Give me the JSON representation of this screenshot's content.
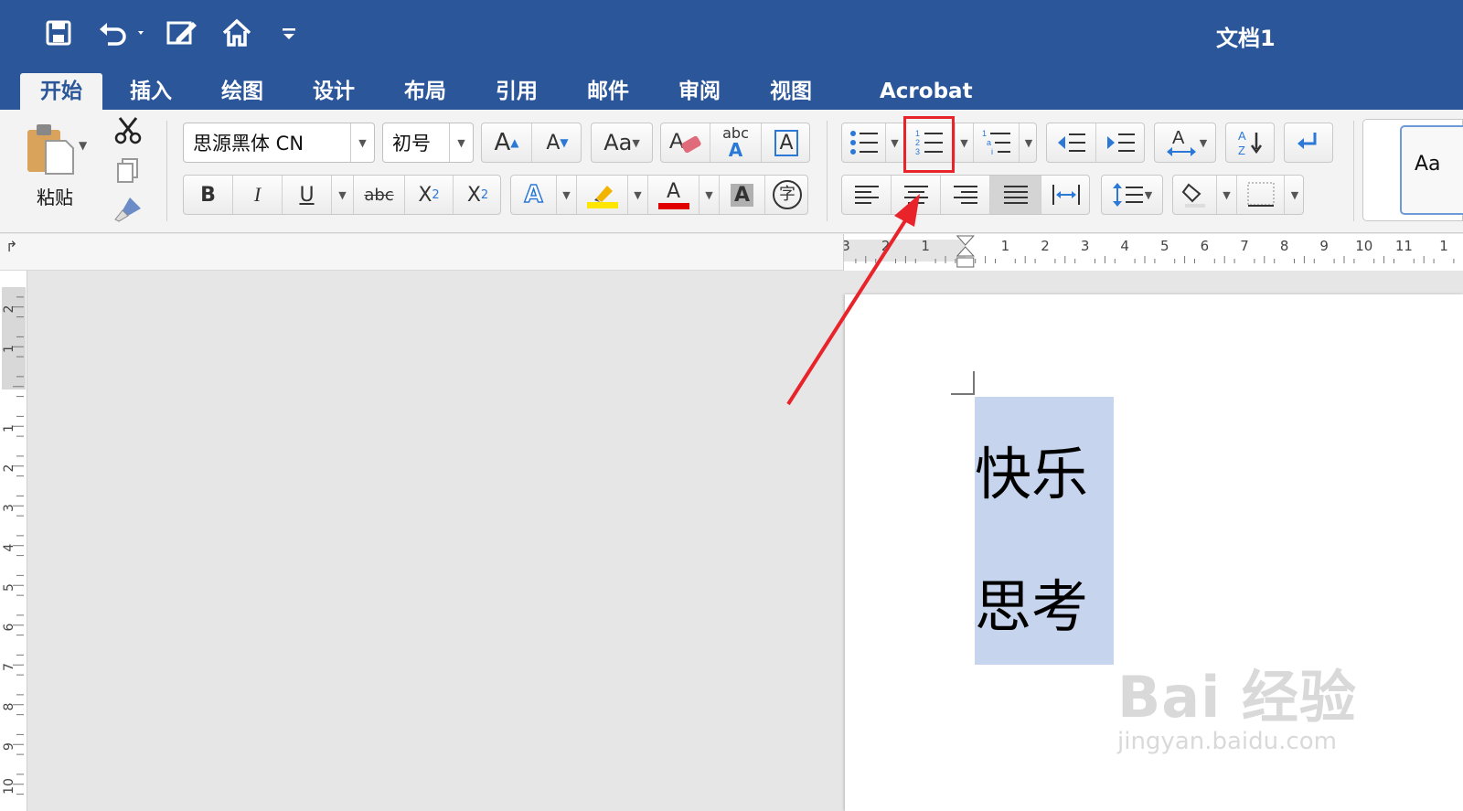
{
  "titlebar": {
    "title": "文档1",
    "icons": [
      "save-icon",
      "undo-icon",
      "edit-icon",
      "home-icon",
      "customize-icon"
    ]
  },
  "tabs": [
    {
      "label": "开始",
      "active": true
    },
    {
      "label": "插入",
      "active": false
    },
    {
      "label": "绘图",
      "active": false
    },
    {
      "label": "设计",
      "active": false
    },
    {
      "label": "布局",
      "active": false
    },
    {
      "label": "引用",
      "active": false
    },
    {
      "label": "邮件",
      "active": false
    },
    {
      "label": "审阅",
      "active": false
    },
    {
      "label": "视图",
      "active": false
    },
    {
      "label": "Acrobat",
      "active": false
    }
  ],
  "clipboard": {
    "paste_label": "粘贴"
  },
  "font": {
    "name": "思源黑体 CN",
    "size": "初号",
    "abc": "abc",
    "highlight_color": "#ffe600",
    "font_color": "#e00000"
  },
  "styles": {
    "preview": "Aa"
  },
  "document": {
    "lines": [
      "快乐",
      "思考"
    ],
    "selection_color": "#c6d4ee"
  },
  "ruler": {
    "h_ticks": [
      "3",
      "2",
      "1",
      "1",
      "2",
      "3",
      "4",
      "5",
      "6",
      "7",
      "8",
      "9",
      "10",
      "11",
      "1"
    ],
    "v_ticks": [
      "2",
      "1",
      "1",
      "2",
      "3",
      "4",
      "5",
      "6",
      "7",
      "8",
      "9",
      "10"
    ]
  },
  "annotation": {
    "highlight_target": "numbering-button",
    "color": "#e8232a"
  },
  "watermark": {
    "line1": "Bai 经验",
    "line2": "jingyan.baidu.com"
  },
  "colors": {
    "brand": "#2b579a",
    "ribbon": "#f3f3f3"
  }
}
